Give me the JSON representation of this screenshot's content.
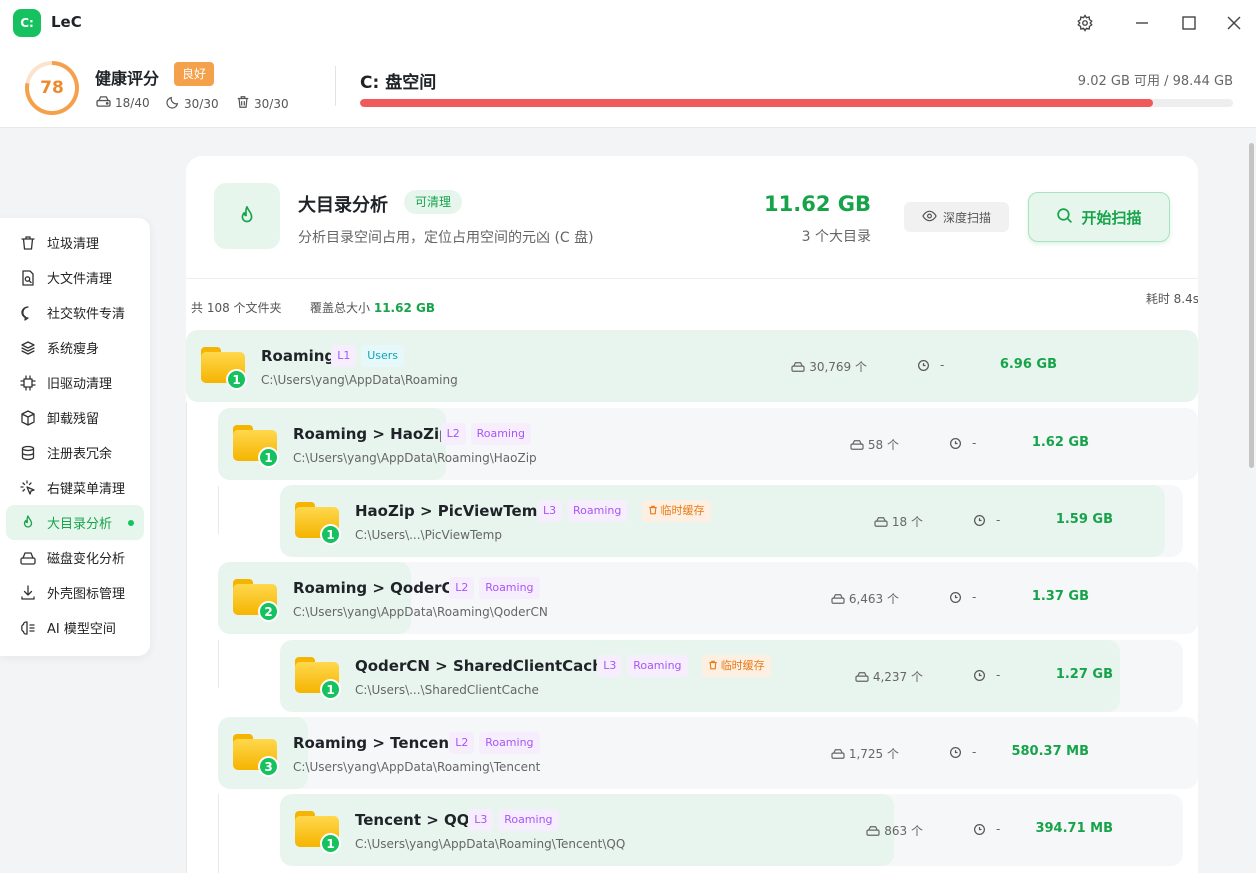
{
  "app": {
    "logo": "C:",
    "title": "LeC"
  },
  "window_controls": [
    "gear-icon",
    "minimize-icon",
    "maximize-icon",
    "close-icon"
  ],
  "health": {
    "score": "78",
    "title": "健康评分",
    "badge": "良好",
    "stats": [
      {
        "icon": "disk-icon",
        "value": "18/40"
      },
      {
        "icon": "moon-icon",
        "value": "30/30"
      },
      {
        "icon": "trash-icon",
        "value": "30/30"
      }
    ]
  },
  "disk": {
    "title": "C: 盘空间",
    "usage": "9.02 GB 可用 / 98.44 GB",
    "used_fraction": 0.908
  },
  "sidebar": {
    "items": [
      {
        "label": "垃圾清理",
        "icon": "trash-icon"
      },
      {
        "label": "大文件清理",
        "icon": "file-search-icon"
      },
      {
        "label": "社交软件专清",
        "icon": "chat-icon"
      },
      {
        "label": "系统瘦身",
        "icon": "layers-icon"
      },
      {
        "label": "旧驱动清理",
        "icon": "chip-icon"
      },
      {
        "label": "卸载残留",
        "icon": "package-icon"
      },
      {
        "label": "注册表冗余",
        "icon": "database-icon"
      },
      {
        "label": "右键菜单清理",
        "icon": "pointer-icon"
      },
      {
        "label": "大目录分析",
        "icon": "flame-icon",
        "active": true
      },
      {
        "label": "磁盘变化分析",
        "icon": "harddrive-icon"
      },
      {
        "label": "外壳图标管理",
        "icon": "download-icon"
      },
      {
        "label": "AI 模型空间",
        "icon": "brain-icon"
      }
    ]
  },
  "panel": {
    "title": "大目录分析",
    "badge": "可清理",
    "subtitle": "分析目录空间占用，定位占用空间的元凶 (C 盘)",
    "total_size": "11.62 GB",
    "total_count": "3 个大目录",
    "deep_scan": "深度扫描",
    "start_scan": "开始扫描",
    "summary_folders": "共 108 个文件夹",
    "summary_size_label": "覆盖总大小",
    "summary_size": "11.62 GB",
    "elapsed": "耗时 8.4s"
  },
  "rows": [
    {
      "level": 1,
      "rank": "1",
      "name": "Roaming",
      "level_tag": "L1",
      "parent_tag": "Users",
      "path": "C:\\Users\\yang\\AppData\\Roaming",
      "count": "30,769 个",
      "time": "-",
      "size": "6.96 GB",
      "fraction": 1.0
    },
    {
      "level": 2,
      "rank": "1",
      "name": "Roaming > HaoZip",
      "level_tag": "L2",
      "parent_tag": "Roaming",
      "path": "C:\\Users\\yang\\AppData\\Roaming\\HaoZip",
      "count": "58 个",
      "time": "-",
      "size": "1.62 GB",
      "fraction": 0.233
    },
    {
      "level": 3,
      "rank": "1",
      "name": "HaoZip > PicViewTemp",
      "level_tag": "L3",
      "parent_tag": "Roaming",
      "temp_tag": "临时缓存",
      "path": "C:\\Users\\...\\PicViewTemp",
      "count": "18 个",
      "time": "-",
      "size": "1.59 GB",
      "fraction": 0.98
    },
    {
      "level": 2,
      "rank": "2",
      "name": "Roaming > QoderCN",
      "level_tag": "L2",
      "parent_tag": "Roaming",
      "path": "C:\\Users\\yang\\AppData\\Roaming\\QoderCN",
      "count": "6,463 个",
      "time": "-",
      "size": "1.37 GB",
      "fraction": 0.197
    },
    {
      "level": 3,
      "rank": "1",
      "name": "QoderCN > SharedClientCache",
      "level_tag": "L3",
      "parent_tag": "Roaming",
      "temp_tag": "临时缓存",
      "path": "C:\\Users\\...\\SharedClientCache",
      "count": "4,237 个",
      "time": "-",
      "size": "1.27 GB",
      "fraction": 0.93
    },
    {
      "level": 2,
      "rank": "3",
      "name": "Roaming > Tencent",
      "level_tag": "L2",
      "parent_tag": "Roaming",
      "path": "C:\\Users\\yang\\AppData\\Roaming\\Tencent",
      "count": "1,725 个",
      "time": "-",
      "size": "580.37 MB",
      "fraction": 0.081
    },
    {
      "level": 3,
      "rank": "1",
      "name": "Tencent > QQ",
      "level_tag": "L3",
      "parent_tag": "Roaming",
      "path": "C:\\Users\\yang\\AppData\\Roaming\\Tencent\\QQ",
      "count": "863 个",
      "time": "-",
      "size": "394.71 MB",
      "fraction": 0.68
    }
  ],
  "colors": {
    "accent": "#16a34a",
    "accent_light": "#e6f6ed",
    "warning": "#f5a04b",
    "danger": "#f05a5a"
  }
}
